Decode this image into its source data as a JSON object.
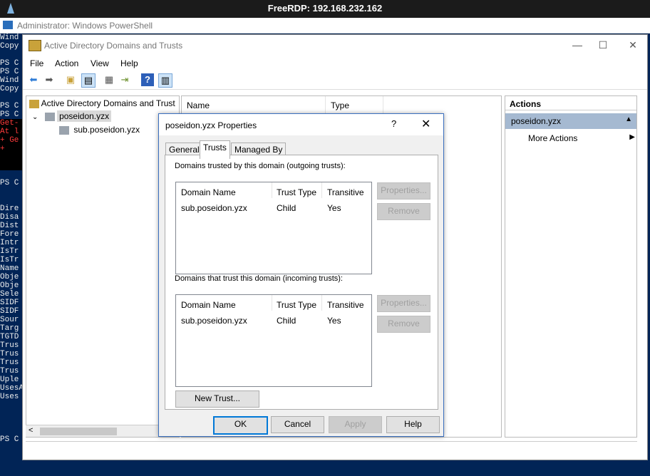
{
  "rdp": {
    "title": "FreeRDP: 192.168.232.162"
  },
  "powershell": {
    "title": "Administrator: Windows PowerShell",
    "console_lines": [
      {
        "text": "Wind",
        "cls": ""
      },
      {
        "text": "Copy",
        "cls": ""
      },
      {
        "text": "",
        "cls": ""
      },
      {
        "text": "PS C",
        "cls": ""
      },
      {
        "text": "PS C",
        "cls": ""
      },
      {
        "text": "Wind",
        "cls": ""
      },
      {
        "text": "Copy",
        "cls": ""
      },
      {
        "text": "",
        "cls": ""
      },
      {
        "text": "PS C",
        "cls": ""
      },
      {
        "text": "PS C",
        "cls": ""
      },
      {
        "text": "Get-",
        "cls": "err errblk"
      },
      {
        "text": "At l",
        "cls": "err errblk"
      },
      {
        "text": "+ Ge",
        "cls": "err errblk"
      },
      {
        "text": "+",
        "cls": "err errblk"
      },
      {
        "text": "",
        "cls": "errblk"
      },
      {
        "text": "",
        "cls": "errblk"
      },
      {
        "text": "",
        "cls": ""
      },
      {
        "text": "PS C",
        "cls": ""
      },
      {
        "text": "",
        "cls": ""
      },
      {
        "text": "",
        "cls": ""
      },
      {
        "text": "Dire",
        "cls": ""
      },
      {
        "text": "Disa",
        "cls": ""
      },
      {
        "text": "Dist",
        "cls": ""
      },
      {
        "text": "Fore",
        "cls": ""
      },
      {
        "text": "Intr",
        "cls": ""
      },
      {
        "text": "IsTr",
        "cls": ""
      },
      {
        "text": "IsTr",
        "cls": ""
      },
      {
        "text": "Name",
        "cls": ""
      },
      {
        "text": "Obje",
        "cls": ""
      },
      {
        "text": "Obje",
        "cls": ""
      },
      {
        "text": "Sele",
        "cls": ""
      },
      {
        "text": "SIDF",
        "cls": ""
      },
      {
        "text": "SIDF",
        "cls": ""
      },
      {
        "text": "Sour",
        "cls": ""
      },
      {
        "text": "Targ",
        "cls": ""
      },
      {
        "text": "TGTD",
        "cls": ""
      },
      {
        "text": "Trus",
        "cls": ""
      },
      {
        "text": "Trus",
        "cls": ""
      },
      {
        "text": "Trus",
        "cls": ""
      },
      {
        "text": "Trus",
        "cls": ""
      },
      {
        "text": "Uple",
        "cls": ""
      },
      {
        "text": "UsesA",
        "cls": ""
      },
      {
        "text": "Uses",
        "cls": ""
      },
      {
        "text": "",
        "cls": ""
      },
      {
        "text": "",
        "cls": ""
      },
      {
        "text": "",
        "cls": ""
      },
      {
        "text": "",
        "cls": ""
      },
      {
        "text": "PS C",
        "cls": ""
      }
    ]
  },
  "ad": {
    "title": "Active Directory Domains and Trusts",
    "menu": [
      "File",
      "Action",
      "View",
      "Help"
    ],
    "tree": {
      "root": "Active Directory Domains and Trust",
      "domain": "poseidon.yzx",
      "child": "sub.poseidon.yzx"
    },
    "list_columns": [
      "Name",
      "Type"
    ],
    "actions": {
      "header": "Actions",
      "selected": "poseidon.yzx",
      "more": "More Actions"
    }
  },
  "dialog": {
    "title": "poseidon.yzx Properties",
    "help_glyph": "?",
    "close_glyph": "✕",
    "tabs": [
      "General",
      "Trusts",
      "Managed By"
    ],
    "active_tab": "Trusts",
    "outgoing": {
      "label": "Domains trusted by this domain (outgoing trusts):",
      "columns": [
        "Domain Name",
        "Trust Type",
        "Transitive"
      ],
      "rows": [
        [
          "sub.poseidon.yzx",
          "Child",
          "Yes"
        ]
      ],
      "properties_button": "Properties...",
      "remove_button": "Remove"
    },
    "incoming": {
      "label": "Domains that trust this domain (incoming trusts):",
      "columns": [
        "Domain Name",
        "Trust Type",
        "Transitive"
      ],
      "rows": [
        [
          "sub.poseidon.yzx",
          "Child",
          "Yes"
        ]
      ],
      "properties_button": "Properties...",
      "remove_button": "Remove"
    },
    "new_trust_button": "New Trust...",
    "buttons": {
      "ok": "OK",
      "cancel": "Cancel",
      "apply": "Apply",
      "help": "Help"
    }
  }
}
